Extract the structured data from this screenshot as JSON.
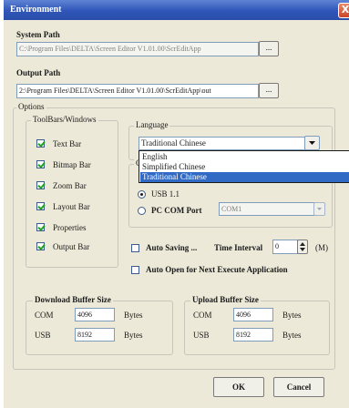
{
  "window": {
    "title": "Environment",
    "close_glyph": "X"
  },
  "system_path": {
    "label": "System Path",
    "value": "C:\\Program Files\\DELTA\\Screen Editor V1.01.00\\ScrEditApp",
    "browse_label": "..."
  },
  "output_path": {
    "label": "Output Path",
    "value": "2:\\Program Files\\DELTA\\Screen Editor V1.01.00\\ScrEditApp\\out",
    "browse_label": "..."
  },
  "options": {
    "label": "Options"
  },
  "toolbars": {
    "label": "ToolBars/Windows",
    "items": [
      {
        "label": "Text Bar",
        "checked": true
      },
      {
        "label": "Bitmap Bar",
        "checked": true
      },
      {
        "label": "Zoom Bar",
        "checked": true
      },
      {
        "label": "Layout Bar",
        "checked": true
      },
      {
        "label": "Properties",
        "checked": true
      },
      {
        "label": "Output Bar",
        "checked": true
      }
    ]
  },
  "language": {
    "label": "Language",
    "selected": "Traditional Chinese",
    "options": [
      "English",
      "Simplified Chinese",
      "Traditional Chinese"
    ]
  },
  "communication": {
    "label_fragment": "C",
    "usb_label": "USB 1.1",
    "pc_com_label": "PC COM Port",
    "com_value": "COM1"
  },
  "auto_saving": {
    "label": "Auto Saving ...",
    "time_label": "Time Interval",
    "value": "0",
    "unit": "(M)"
  },
  "auto_open": {
    "label": "Auto Open for Next Execute Application"
  },
  "download_buffer": {
    "label": "Download Buffer Size",
    "com_label": "COM",
    "com_value": "4096",
    "usb_label": "USB",
    "usb_value": "8192",
    "unit": "Bytes"
  },
  "upload_buffer": {
    "label": "Upload Buffer Size",
    "com_label": "COM",
    "com_value": "4096",
    "usb_label": "USB",
    "usb_value": "8192",
    "unit": "Bytes"
  },
  "buttons": {
    "ok": "OK",
    "cancel": "Cancel"
  }
}
